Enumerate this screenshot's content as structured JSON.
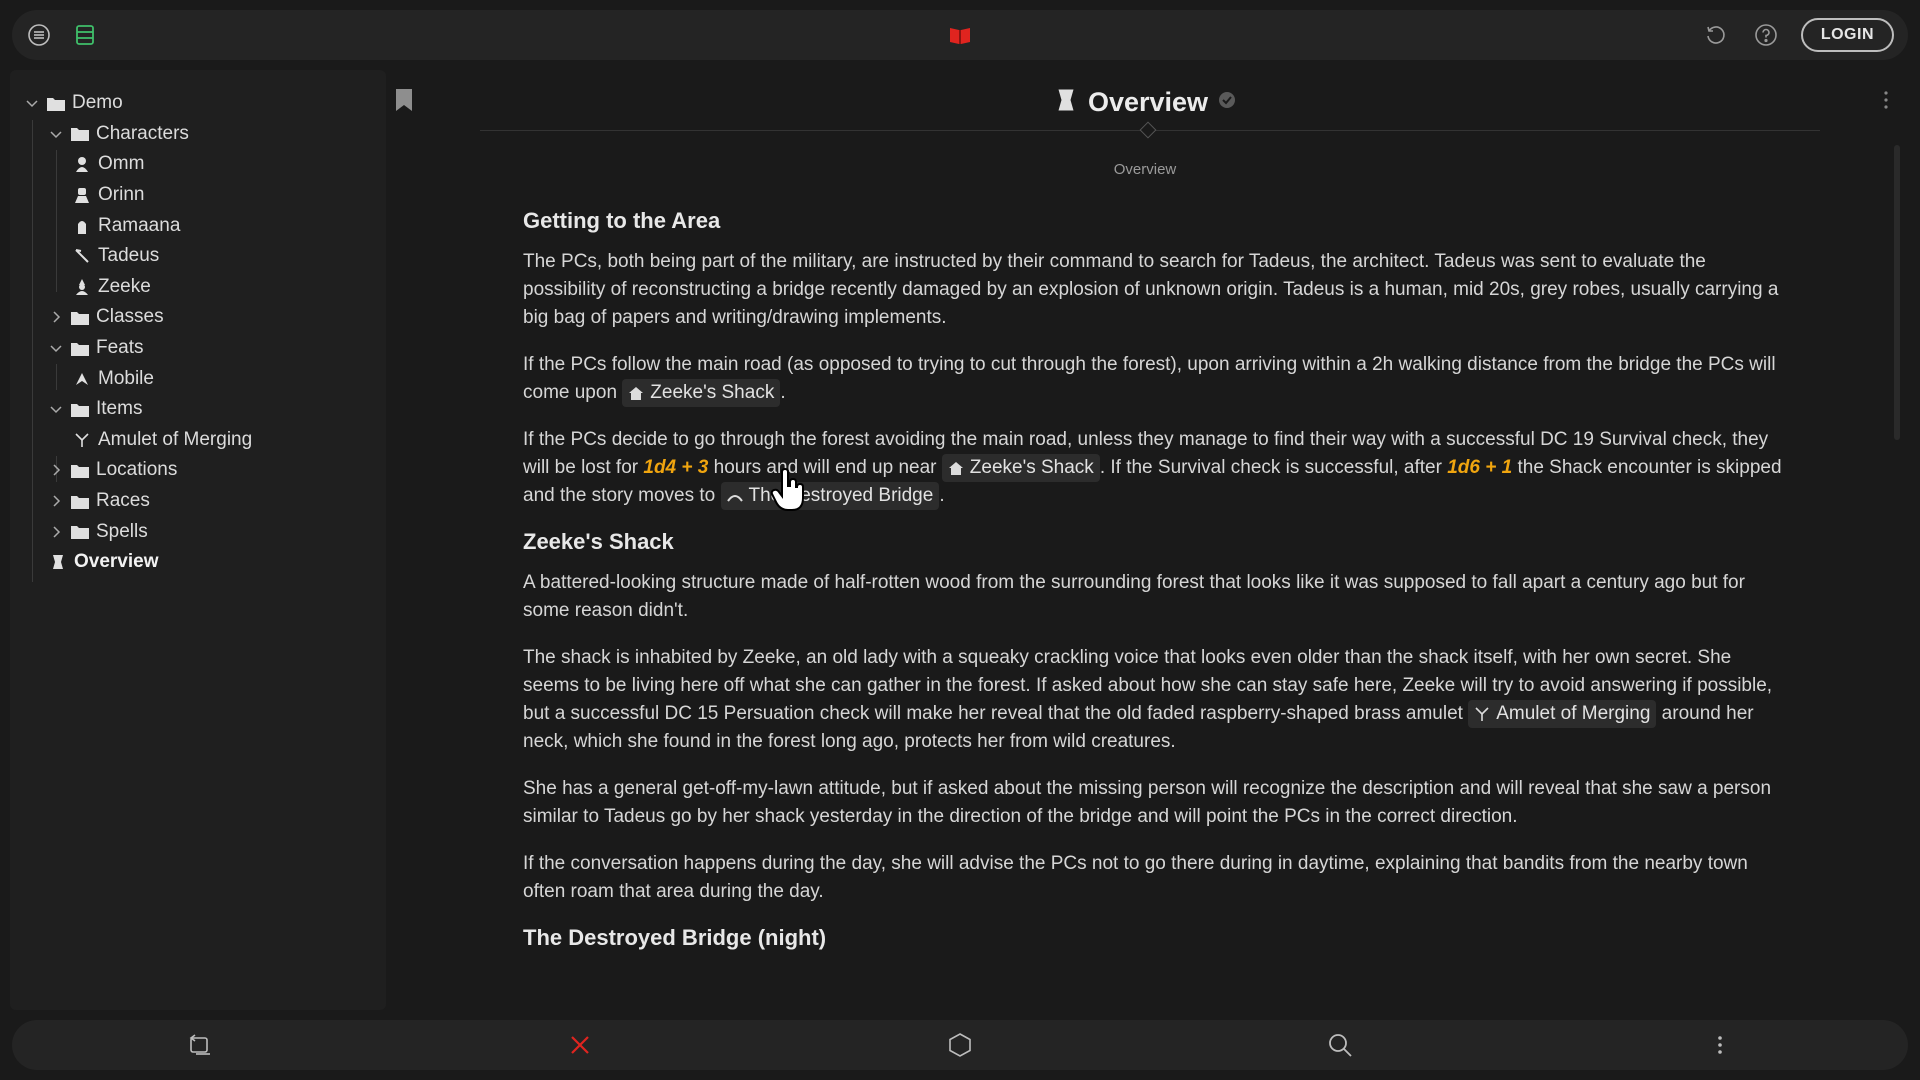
{
  "topbar": {
    "login_label": "LOGIN",
    "accent_color": "#e0241f",
    "left_icons": [
      "menu-icon",
      "inbox-icon"
    ],
    "center_icon": "book-icon",
    "right_icons": [
      "undo-icon",
      "help-icon"
    ]
  },
  "sidebar": {
    "items": [
      {
        "label": "Demo",
        "icon": "folder-icon",
        "level": 0,
        "expanded": true
      },
      {
        "label": "Characters",
        "icon": "folder-icon",
        "level": 1,
        "expanded": true
      },
      {
        "label": "Omm",
        "icon": "character-icon",
        "level": 2
      },
      {
        "label": "Orinn",
        "icon": "character-icon",
        "level": 2
      },
      {
        "label": "Ramaana",
        "icon": "character-icon",
        "level": 2
      },
      {
        "label": "Tadeus",
        "icon": "quill-icon",
        "level": 2
      },
      {
        "label": "Zeeke",
        "icon": "character-icon",
        "level": 2
      },
      {
        "label": "Classes",
        "icon": "folder-icon",
        "level": 1,
        "expanded": false
      },
      {
        "label": "Feats",
        "icon": "folder-icon",
        "level": 1,
        "expanded": true
      },
      {
        "label": "Mobile",
        "icon": "feat-icon",
        "level": 2
      },
      {
        "label": "Items",
        "icon": "folder-icon",
        "level": 1,
        "expanded": true
      },
      {
        "label": "Amulet of Merging",
        "icon": "amulet-icon",
        "level": 2
      },
      {
        "label": "Locations",
        "icon": "folder-icon",
        "level": 1,
        "expanded": false
      },
      {
        "label": "Races",
        "icon": "folder-icon",
        "level": 1,
        "expanded": false
      },
      {
        "label": "Spells",
        "icon": "folder-icon",
        "level": 1,
        "expanded": false
      },
      {
        "label": "Overview",
        "icon": "scroll-icon",
        "level": 0,
        "active": true
      }
    ]
  },
  "main": {
    "title": "Overview",
    "subtitle": "Overview",
    "sections": {
      "s1_heading": "Getting to the Area",
      "p1": "The PCs, both being part of the military, are instructed by their command to search for Tadeus, the architect. Tadeus was sent to evaluate the possibility of reconstructing a bridge recently damaged by an explosion of unknown origin. Tadeus is a human, mid 20s, grey robes, usually carrying a big bag of papers and writing/drawing implements.",
      "p2_a": "If the PCs follow the main road (as opposed to trying to cut through the forest), upon arriving within a 2h walking distance from the bridge the PCs will come upon ",
      "p2_chip": "Zeeke's Shack",
      "p2_b": ".",
      "p3_a": "If the PCs decide to go through the forest avoiding the main road, unless they manage to find their way with a successful DC 19 Survival check, they will be lost for ",
      "p3_roll1": "1d4 + 3",
      "p3_b": " hours and will end up near ",
      "p3_chip1": "Zeeke's Shack",
      "p3_c": ". If the Survival check is successful, after ",
      "p3_roll2": "1d6 + 1",
      "p3_d": " the Shack encounter is skipped and the story moves to ",
      "p3_chip2": "The Destroyed Bridge",
      "p3_e": ".",
      "s2_heading": "Zeeke's Shack",
      "p4": "A battered-looking structure made of half-rotten wood from the surrounding forest that looks like it was supposed to fall apart a century ago but for some reason didn't.",
      "p5_a": "The shack is inhabited by Zeeke, an old lady with a squeaky crackling voice that looks even older than the shack itself, with her own secret. She seems to be living here off what she can gather in the forest. If asked about how she can stay safe here, Zeeke will try to avoid answering if possible, but a successful DC 15 Persuation check will make her reveal that the old faded raspberry-shaped brass amulet ",
      "p5_chip": "Amulet of Merging",
      "p5_b": " around her neck, which she found in the forest long ago, protects her from wild creatures.",
      "p6": "She has a general get-off-my-lawn attitude, but if asked about the missing person will recognize the description and will reveal that she saw a person similar to Tadeus go by her shack yesterday in the direction of the bridge and will point the PCs in the correct direction.",
      "p7": "If the conversation happens during the day, she will advise the PCs not to go there during in daytime, explaining that bandits from the nearby town often roam that area during the day.",
      "s3_heading": "The Destroyed Bridge (night)"
    },
    "roll_color": "#f0a50f"
  },
  "bottombar": {
    "icons": [
      "switch-icon",
      "close-icon",
      "hexagon-icon",
      "search-icon",
      "more-icon"
    ],
    "close_color": "#e0241f"
  }
}
